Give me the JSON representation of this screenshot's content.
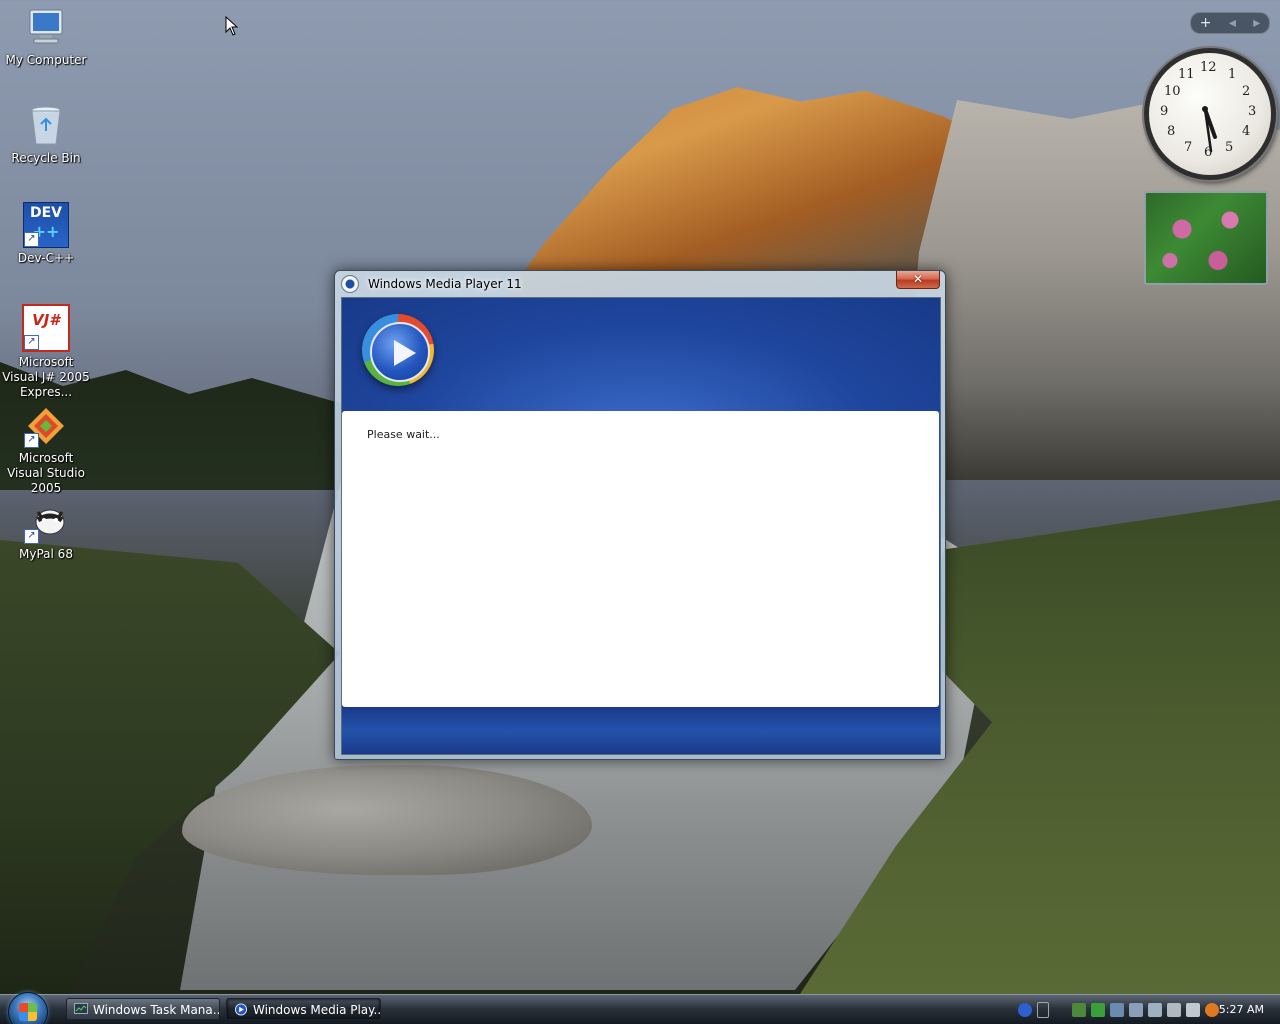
{
  "desktop": {
    "icons": [
      {
        "label": "My Computer"
      },
      {
        "label": "Recycle Bin"
      },
      {
        "label": "Dev-C++",
        "glyph": "DEV"
      },
      {
        "label": "Microsoft Visual J# 2005 Expres...",
        "glyph": "VJ#"
      },
      {
        "label": "Microsoft Visual Studio 2005"
      },
      {
        "label": "MyPal 68"
      }
    ]
  },
  "gadgets": {
    "sidebar_controls": {
      "add": "+",
      "prev": "◂",
      "next": "▸"
    },
    "clock_numbers": [
      "12",
      "1",
      "2",
      "3",
      "4",
      "5",
      "6",
      "7",
      "8",
      "9",
      "10",
      "11"
    ]
  },
  "dialog": {
    "title": "Windows Media Player 11",
    "close_label": "✕",
    "message": "Please wait..."
  },
  "taskbar": {
    "buttons": [
      {
        "label": "Windows Task Mana..."
      },
      {
        "label": "Windows Media Play..."
      }
    ],
    "time": "5:27 AM"
  },
  "colors": {
    "dialog_blue": "#1f469e",
    "taskbar": "#2a323c",
    "close_red": "#b83c22"
  }
}
